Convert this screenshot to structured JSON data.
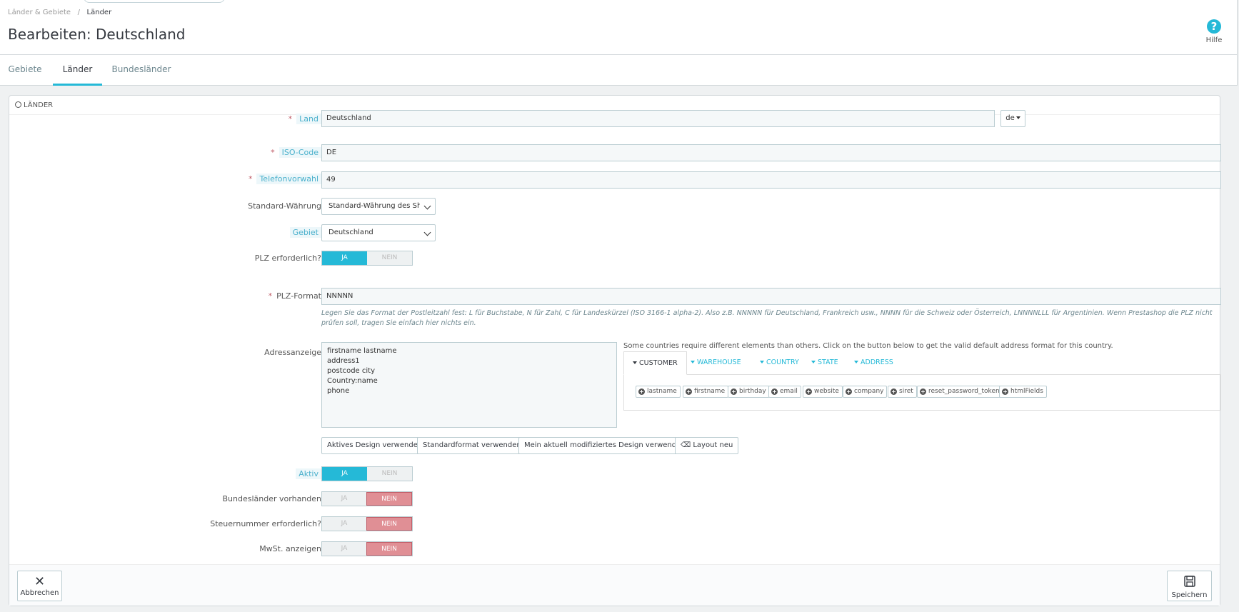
{
  "breadcrumb": {
    "parent": "Länder & Gebiete",
    "current": "Länder"
  },
  "page_title": "Bearbeiten: Deutschland",
  "help": {
    "icon": "?",
    "label": "Hilfe"
  },
  "tabs": [
    {
      "label": "Gebiete"
    },
    {
      "label": "Länder"
    },
    {
      "label": "Bundesländer"
    }
  ],
  "panel": {
    "heading": "Länder"
  },
  "form": {
    "land": {
      "label": "Land",
      "value": "Deutschland",
      "lang": "de"
    },
    "iso": {
      "label": "ISO-Code",
      "value": "DE"
    },
    "phone": {
      "label": "Telefonvorwahl",
      "value": "49"
    },
    "currency": {
      "label": "Standard-Währung",
      "value": "Standard-Währung des Shop"
    },
    "zone": {
      "label": "Gebiet",
      "value": "Deutschland"
    },
    "zip_required": {
      "label": "PLZ erforderlich?",
      "yes": "JA",
      "no": "NEIN"
    },
    "zip_format": {
      "label": "PLZ-Format",
      "value": "NNNNN",
      "help": "Legen Sie das Format der Postleitzahl fest: L für Buchstabe, N für Zahl, C für Landeskürzel (ISO 3166-1 alpha-2). Also z.B. NNNNN für Deutschland, Frankreich usw., NNNN für die Schweiz oder Österreich, LNNNNLLL für Argentinien. Wenn Prestashop die PLZ nicht prüfen soll, tragen Sie einfach hier nichts ein."
    },
    "address": {
      "label": "Adressanzeige",
      "lines": [
        "firstname lastname",
        "address1",
        "postcode city",
        "Country:name",
        "phone"
      ],
      "note": "Some countries require different elements than others. Click on the button below to get the valid default address format for this country.",
      "tabs": [
        "CUSTOMER",
        "WAREHOUSE",
        "COUNTRY",
        "STATE",
        "ADDRESS"
      ],
      "fields": [
        "lastname",
        "firstname",
        "birthday",
        "email",
        "website",
        "company",
        "siret",
        "reset_password_token",
        "htmlFields"
      ]
    },
    "layout_buttons": [
      "Aktives Design verwenden",
      "Standardformat verwenden",
      "Mein aktuell modifiziertes Design verwenden",
      "Layout neu"
    ],
    "active": {
      "label": "Aktiv",
      "yes": "JA",
      "no": "NEIN"
    },
    "states": {
      "label": "Bundesländer vorhanden",
      "yes": "JA",
      "no": "NEIN"
    },
    "vat_required": {
      "label": "Steuernummer erforderlich?",
      "yes": "JA",
      "no": "NEIN"
    },
    "show_vat": {
      "label": "MwSt. anzeigen",
      "yes": "JA",
      "no": "NEIN"
    }
  },
  "footer": {
    "cancel": "Abbrechen",
    "save": "Speichern"
  },
  "colors": {
    "accent": "#25b9d7",
    "danger": "#e08f95",
    "required": "#c05c67"
  }
}
